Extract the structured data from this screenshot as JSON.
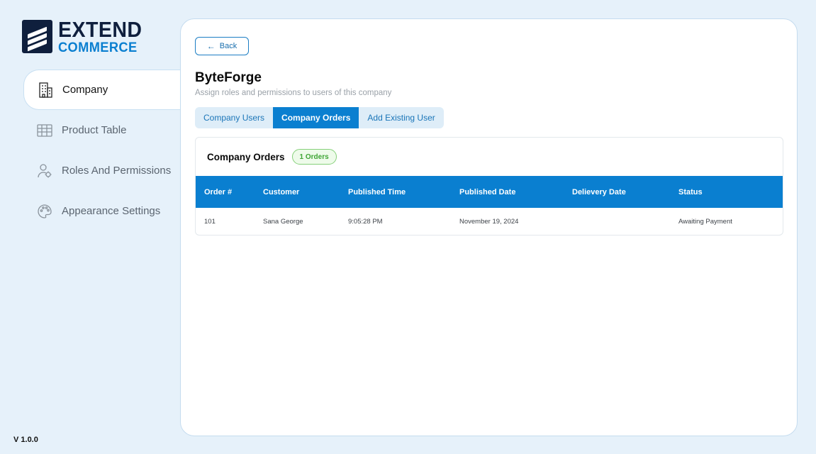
{
  "logo": {
    "line1": "EXTEND",
    "line2": "COMMERCE"
  },
  "sidebar": {
    "items": [
      {
        "label": "Company",
        "icon": "building-icon",
        "active": true
      },
      {
        "label": "Product Table",
        "icon": "table-icon",
        "active": false
      },
      {
        "label": "Roles And Permissions",
        "icon": "user-settings-icon",
        "active": false
      },
      {
        "label": "Appearance Settings",
        "icon": "palette-icon",
        "active": false
      }
    ]
  },
  "version": "V 1.0.0",
  "main": {
    "back_label": "Back",
    "title": "ByteForge",
    "subtitle": "Assign roles and permissions to users of this company",
    "tabs": [
      {
        "label": "Company Users",
        "active": false
      },
      {
        "label": "Company Orders",
        "active": true
      },
      {
        "label": "Add Existing User",
        "active": false
      }
    ],
    "orders": {
      "title": "Company Orders",
      "badge": "1 Orders",
      "columns": [
        "Order #",
        "Customer",
        "Published Time",
        "Published Date",
        "Delievery Date",
        "Status"
      ],
      "rows": [
        [
          "101",
          "Sana George",
          "9:05:28 PM",
          "November 19, 2024",
          "",
          "Awaiting Payment"
        ]
      ]
    }
  },
  "colors": {
    "accent": "#0a7fd0",
    "background": "#e6f1fa",
    "badge_green": "#3fa535",
    "logo_navy": "#0f1f3d"
  }
}
